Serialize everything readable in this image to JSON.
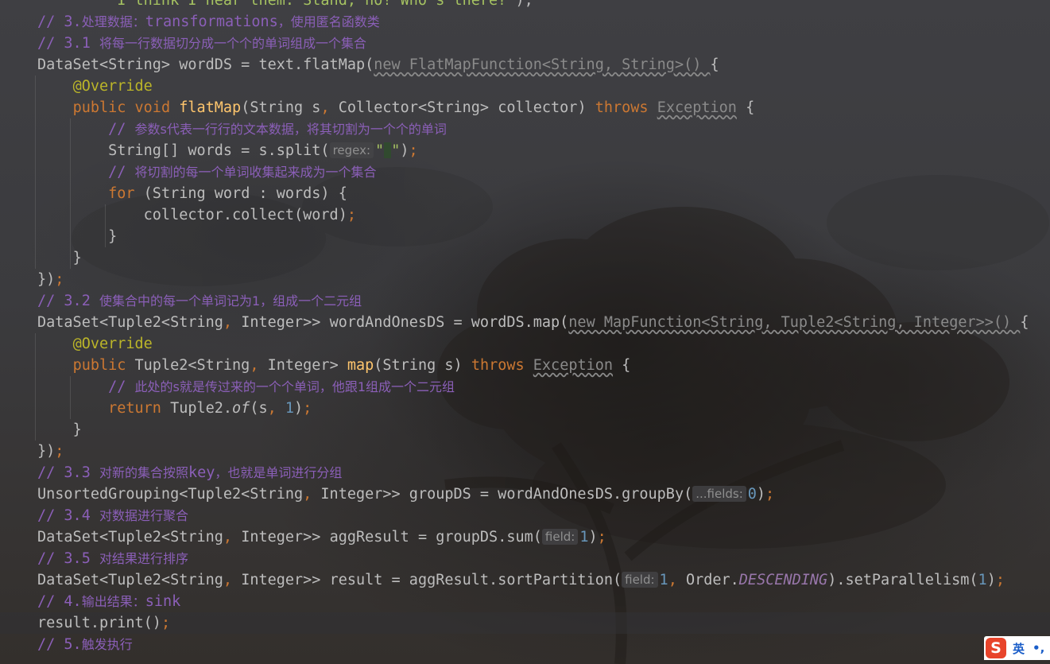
{
  "editor": {
    "lines": [
      {
        "indent": "        ",
        "parts": [
          [
            "str",
            "\"I think I hear them. Stand, ho! Who's there?\""
          ],
          [
            "p",
            ");"
          ]
        ]
      },
      {
        "indent": "",
        "parts": [
          [
            "cmt",
            "// 3."
          ],
          [
            "cmtzh",
            "处理数据："
          ],
          [
            "cmt",
            "transformations"
          ],
          [
            "cmtzh",
            "，使用匿名函数类"
          ]
        ]
      },
      {
        "indent": "",
        "parts": [
          [
            "cmt",
            "// 3.1 "
          ],
          [
            "cmtzh",
            "将每一行数据切分成一个个的单词组成一个集合"
          ]
        ]
      },
      {
        "indent": "",
        "parts": [
          [
            "p",
            "DataSet<String> wordDS = text.flatMap("
          ],
          [
            "gw",
            "new FlatMapFunction<String, String>() "
          ],
          [
            "p",
            "{"
          ]
        ]
      },
      {
        "indent": "    ",
        "parts": [
          [
            "ann",
            "@Override"
          ]
        ]
      },
      {
        "indent": "    ",
        "parts": [
          [
            "kw",
            "public void "
          ],
          [
            "fn",
            "flatMap"
          ],
          [
            "p",
            "(String s"
          ],
          [
            "kw",
            ", "
          ],
          [
            "p",
            "Collector<String> collector) "
          ],
          [
            "kw",
            "throws "
          ],
          [
            "gw",
            "Exception"
          ],
          [
            "p",
            " {"
          ]
        ]
      },
      {
        "indent": "        ",
        "parts": [
          [
            "cmt",
            "// "
          ],
          [
            "cmtzh",
            "参数s代表一行行的文本数据，将其切割为一个个的单词"
          ]
        ]
      },
      {
        "indent": "        ",
        "parts": [
          [
            "p",
            "String[] words = s.split("
          ],
          [
            "hint",
            "regex:"
          ],
          [
            "str",
            "\""
          ],
          [
            "caret",
            ""
          ],
          [
            "str",
            "\""
          ],
          [
            "p",
            ")"
          ],
          [
            "kw",
            ";"
          ]
        ]
      },
      {
        "indent": "        ",
        "parts": [
          [
            "cmt",
            "// "
          ],
          [
            "cmtzh",
            "将切割的每一个单词收集起来成为一个集合"
          ]
        ]
      },
      {
        "indent": "        ",
        "parts": [
          [
            "kw",
            "for "
          ],
          [
            "p",
            "(String word : words) {"
          ]
        ]
      },
      {
        "indent": "            ",
        "parts": [
          [
            "p",
            "collector.collect(word)"
          ],
          [
            "kw",
            ";"
          ]
        ]
      },
      {
        "indent": "        ",
        "parts": [
          [
            "p",
            "}"
          ]
        ]
      },
      {
        "indent": "    ",
        "parts": [
          [
            "p",
            "}"
          ]
        ]
      },
      {
        "indent": "",
        "parts": [
          [
            "p",
            "})"
          ],
          [
            "kw",
            ";"
          ]
        ]
      },
      {
        "indent": "",
        "parts": [
          [
            "cmt",
            "// 3.2 "
          ],
          [
            "cmtzh",
            "使集合中的每一个单词记为1，组成一个二元组"
          ]
        ]
      },
      {
        "indent": "",
        "parts": [
          [
            "p",
            "DataSet<Tuple2<String"
          ],
          [
            "kw",
            ", "
          ],
          [
            "p",
            "Integer>> wordAndOnesDS = wordDS.map("
          ],
          [
            "gw",
            "new MapFunction<String, Tuple2<String, Integer>>() "
          ],
          [
            "p",
            "{"
          ]
        ]
      },
      {
        "indent": "    ",
        "parts": [
          [
            "ann",
            "@Override"
          ]
        ]
      },
      {
        "indent": "    ",
        "parts": [
          [
            "kw",
            "public "
          ],
          [
            "p",
            "Tuple2<String"
          ],
          [
            "kw",
            ", "
          ],
          [
            "p",
            "Integer> "
          ],
          [
            "fn",
            "map"
          ],
          [
            "p",
            "(String s) "
          ],
          [
            "kw",
            "throws "
          ],
          [
            "gw",
            "Exception"
          ],
          [
            "p",
            " {"
          ]
        ]
      },
      {
        "indent": "        ",
        "parts": [
          [
            "cmt",
            "// "
          ],
          [
            "cmtzh",
            "此处的s就是传过来的一个个单词，他跟1组成一个二元组"
          ]
        ]
      },
      {
        "indent": "        ",
        "parts": [
          [
            "kw",
            "return "
          ],
          [
            "p",
            "Tuple2."
          ],
          [
            "it",
            "of"
          ],
          [
            "p",
            "(s"
          ],
          [
            "kw",
            ", "
          ],
          [
            "num",
            "1"
          ],
          [
            "p",
            ")"
          ],
          [
            "kw",
            ";"
          ]
        ]
      },
      {
        "indent": "    ",
        "parts": [
          [
            "p",
            "}"
          ]
        ]
      },
      {
        "indent": "",
        "parts": [
          [
            "p",
            "})"
          ],
          [
            "kw",
            ";"
          ]
        ]
      },
      {
        "indent": "",
        "parts": [
          [
            "cmt",
            "// 3.3 "
          ],
          [
            "cmtzh",
            "对新的集合按照"
          ],
          [
            "cmt",
            "key"
          ],
          [
            "cmtzh",
            "，也就是单词进行分组"
          ]
        ]
      },
      {
        "indent": "",
        "parts": [
          [
            "p",
            "UnsortedGrouping<Tuple2<String"
          ],
          [
            "kw",
            ", "
          ],
          [
            "p",
            "Integer>> groupDS = wordAndOnesDS.groupBy("
          ],
          [
            "hint",
            "...fields:"
          ],
          [
            "num",
            "0"
          ],
          [
            "p",
            ")"
          ],
          [
            "kw",
            ";"
          ]
        ]
      },
      {
        "indent": "",
        "parts": [
          [
            "cmt",
            "// 3.4 "
          ],
          [
            "cmtzh",
            "对数据进行聚合"
          ]
        ]
      },
      {
        "indent": "",
        "parts": [
          [
            "p",
            "DataSet<Tuple2<String"
          ],
          [
            "kw",
            ", "
          ],
          [
            "p",
            "Integer>> aggResult = groupDS.sum("
          ],
          [
            "hint",
            "field:"
          ],
          [
            "num",
            "1"
          ],
          [
            "p",
            ")"
          ],
          [
            "kw",
            ";"
          ]
        ]
      },
      {
        "indent": "",
        "parts": [
          [
            "cmt",
            "// 3.5 "
          ],
          [
            "cmtzh",
            "对结果进行排序"
          ]
        ]
      },
      {
        "indent": "",
        "parts": [
          [
            "p",
            "DataSet<Tuple2<String"
          ],
          [
            "kw",
            ", "
          ],
          [
            "p",
            "Integer>> result = aggResult.sortPartition("
          ],
          [
            "hint",
            "field:"
          ],
          [
            "num",
            "1"
          ],
          [
            "kw",
            ", "
          ],
          [
            "p",
            "Order."
          ],
          [
            "ic",
            "DESCENDING"
          ],
          [
            "p",
            ").setParallelism("
          ],
          [
            "num",
            "1"
          ],
          [
            "p",
            ")"
          ],
          [
            "kw",
            ";"
          ]
        ]
      },
      {
        "indent": "",
        "parts": [
          [
            "cmt",
            "// 4."
          ],
          [
            "cmtzh",
            "输出结果："
          ],
          [
            "cmt",
            "sink"
          ]
        ]
      },
      {
        "indent": "",
        "parts": [
          [
            "p",
            "result.print()"
          ],
          [
            "kw",
            ";"
          ]
        ]
      },
      {
        "indent": "",
        "parts": [
          [
            "cmt",
            "// 5."
          ],
          [
            "cmtzh",
            "触发执行"
          ]
        ]
      }
    ]
  },
  "ime": {
    "logo": "S",
    "language": "英",
    "punctuation": "•,"
  },
  "colors": {
    "keyword": "#cc7832",
    "annotation": "#bbb529",
    "function": "#ffc66d",
    "number": "#6897bb",
    "string": "#a5c261",
    "comment": "#8b5fb8",
    "plain": "#bdbdbd"
  }
}
